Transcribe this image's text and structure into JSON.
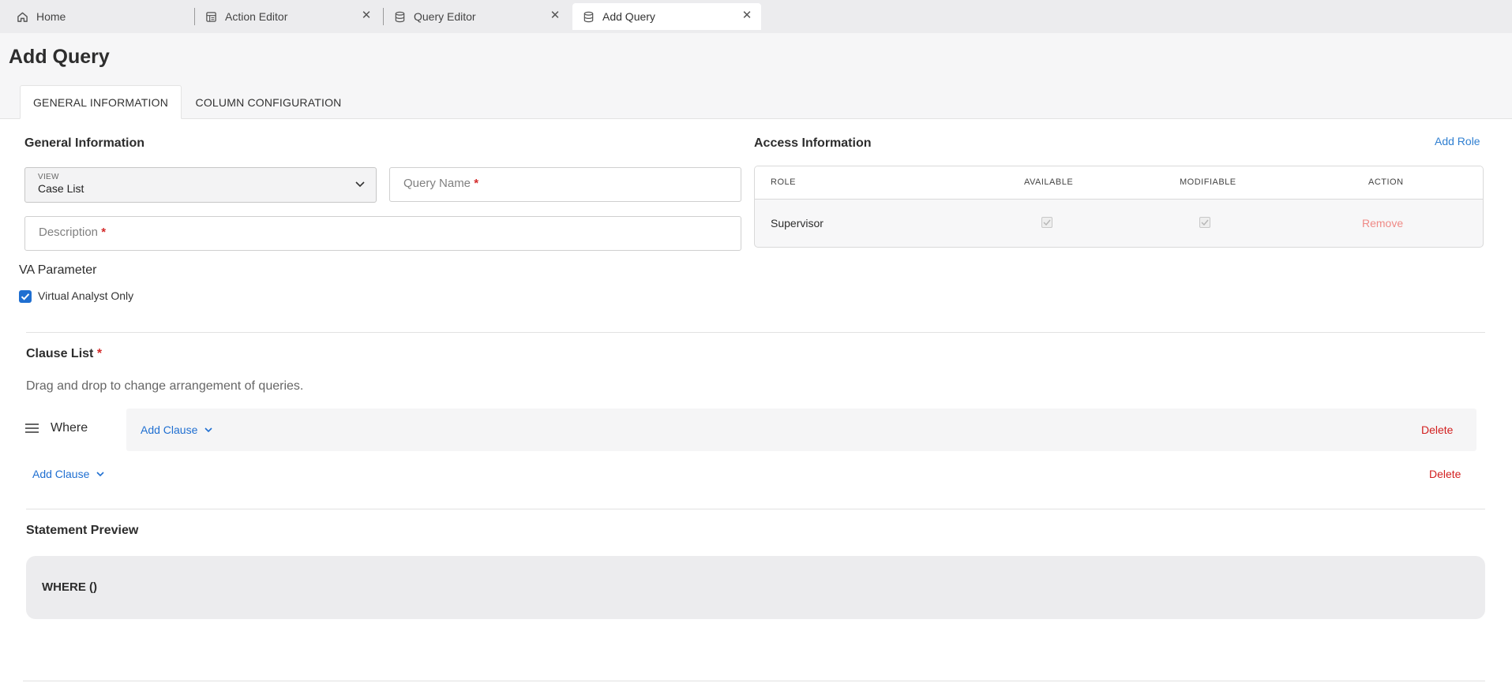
{
  "tabs": [
    {
      "label": "Home",
      "icon": "home-icon",
      "closable": false,
      "active": false
    },
    {
      "label": "Action Editor",
      "icon": "action-editor-icon",
      "closable": true,
      "active": false
    },
    {
      "label": "Query Editor",
      "icon": "database-icon",
      "closable": true,
      "active": false
    },
    {
      "label": "Add Query",
      "icon": "database-icon",
      "closable": true,
      "active": true
    }
  ],
  "close_glyph": "✕",
  "page": {
    "title": "Add Query",
    "tabs": [
      {
        "label": "GENERAL INFORMATION",
        "active": true
      },
      {
        "label": "COLUMN CONFIGURATION",
        "active": false
      }
    ]
  },
  "general": {
    "title": "General Information",
    "view": {
      "label": "VIEW",
      "value": "Case List"
    },
    "query_name": {
      "placeholder": "Query Name",
      "required_mark": "*"
    },
    "description": {
      "placeholder": "Description",
      "required_mark": "*"
    }
  },
  "access": {
    "title": "Access Information",
    "add_role_label": "Add Role",
    "columns": [
      "ROLE",
      "AVAILABLE",
      "MODIFIABLE",
      "ACTION"
    ],
    "rows": [
      {
        "role": "Supervisor",
        "available": true,
        "modifiable": true,
        "action": "Remove"
      }
    ]
  },
  "va": {
    "title": "VA Parameter",
    "checkbox_label": "Virtual Analyst Only",
    "checked": true
  },
  "clauses": {
    "title": "Clause List",
    "required_mark": "*",
    "hint": "Drag and drop to change arrangement of queries.",
    "where_label": "Where",
    "inner_add_label": "Add Clause",
    "inner_delete_label": "Delete",
    "outer_add_label": "Add Clause",
    "outer_delete_label": "Delete"
  },
  "preview": {
    "title": "Statement Preview",
    "statement": "WHERE ()"
  },
  "colors": {
    "accent_blue": "#1f6fd1",
    "link_blue": "#2f7fd1",
    "delete_red": "#d21f1f",
    "required_red": "#d42b2b",
    "remove_faded_red": "#ef8a86"
  }
}
